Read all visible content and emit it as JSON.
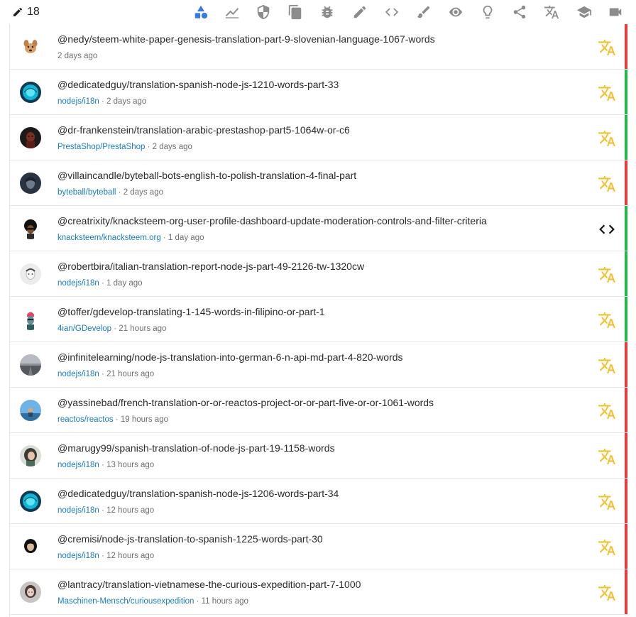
{
  "header": {
    "count": "18",
    "accent": "#3a79e2",
    "icon_color": "#8c8c8c",
    "icons": [
      {
        "name": "all-categories-icon"
      },
      {
        "name": "analysis-icon"
      },
      {
        "name": "security-icon"
      },
      {
        "name": "documentation-icon"
      },
      {
        "name": "bug-hunting-icon"
      },
      {
        "name": "copywriting-icon"
      },
      {
        "name": "development-icon"
      },
      {
        "name": "graphics-icon"
      },
      {
        "name": "visibility-icon"
      },
      {
        "name": "ideas-icon"
      },
      {
        "name": "social-icon"
      },
      {
        "name": "translations-icon"
      },
      {
        "name": "tutorials-icon"
      },
      {
        "name": "video-tutorials-icon"
      }
    ]
  },
  "colors": {
    "green": "#21ba45",
    "red": "#ea3b3b",
    "translation_icon": "#f2c12e",
    "link": "#1a7cc1"
  },
  "posts": [
    {
      "title": "@nedy/steem-white-paper-genesis-translation-part-9-slovenian-language-1067-words",
      "repo": "",
      "time": "2 days ago",
      "category_icon": "translation-icon",
      "status": "red",
      "avatar": "dog"
    },
    {
      "title": "@dedicatedguy/translation-spanish-node-js-1210-words-part-33",
      "repo": "nodejs/i18n",
      "time": "2 days ago",
      "category_icon": "translation-icon",
      "status": "green",
      "avatar": "cyan"
    },
    {
      "title": "@dr-frankenstein/translation-arabic-prestashop-part5-1064w-or-c6",
      "repo": "PrestaShop/PrestaShop",
      "time": "2 days ago",
      "category_icon": "translation-icon",
      "status": "green",
      "avatar": "dark"
    },
    {
      "title": "@villaincandle/byteball-bots-english-to-polish-translation-4-final-part",
      "repo": "byteball/byteball",
      "time": "2 days ago",
      "category_icon": "translation-icon",
      "status": "red",
      "avatar": "navy"
    },
    {
      "title": "@creatrixity/knacksteem-org-user-profile-dashboard-update-moderation-controls-and-filter-criteria",
      "repo": "knacksteem/knacksteem.org",
      "time": "1 day ago",
      "category_icon": "code-icon",
      "status": "green",
      "avatar": "afro"
    },
    {
      "title": "@robertbira/italian-translation-report-node-js-part-49-2126-tw-1320cw",
      "repo": "nodejs/i18n",
      "time": "1 day ago",
      "category_icon": "translation-icon",
      "status": "green",
      "avatar": "light"
    },
    {
      "title": "@toffer/gdevelop-translating-1-145-words-in-filipino-or-part-1",
      "repo": "4ian/GDevelop",
      "time": "21 hours ago",
      "category_icon": "translation-icon",
      "status": "green",
      "avatar": "punk"
    },
    {
      "title": "@infinitelearning/node-js-translation-into-german-6-n-api-md-part-4-820-words",
      "repo": "nodejs/i18n",
      "time": "21 hours ago",
      "category_icon": "translation-icon",
      "status": "red",
      "avatar": "road"
    },
    {
      "title": "@yassinebad/french-translation-or-or-reactos-project-or-or-part-five-or-or-1061-words",
      "repo": "reactos/reactos",
      "time": "19 hours ago",
      "category_icon": "translation-icon",
      "status": "red",
      "avatar": "sky"
    },
    {
      "title": "@marugy99/spanish-translation-of-node-js-part-19-1158-words",
      "repo": "nodejs/i18n",
      "time": "13 hours ago",
      "category_icon": "translation-icon",
      "status": "red",
      "avatar": "girl"
    },
    {
      "title": "@dedicatedguy/translation-spanish-node-js-1206-words-part-34",
      "repo": "nodejs/i18n",
      "time": "12 hours ago",
      "category_icon": "translation-icon",
      "status": "red",
      "avatar": "cyan"
    },
    {
      "title": "@cremisi/node-js-translation-to-spanish-1225-words-part-30",
      "repo": "nodejs/i18n",
      "time": "12 hours ago",
      "category_icon": "translation-icon",
      "status": "red",
      "avatar": "darkgirl"
    },
    {
      "title": "@lantracy/translation-vietnamese-the-curious-expedition-part-7-1000",
      "repo": "Maschinen-Mensch/curiousexpedition",
      "time": "11 hours ago",
      "category_icon": "translation-icon",
      "status": "red",
      "avatar": "woman"
    }
  ]
}
